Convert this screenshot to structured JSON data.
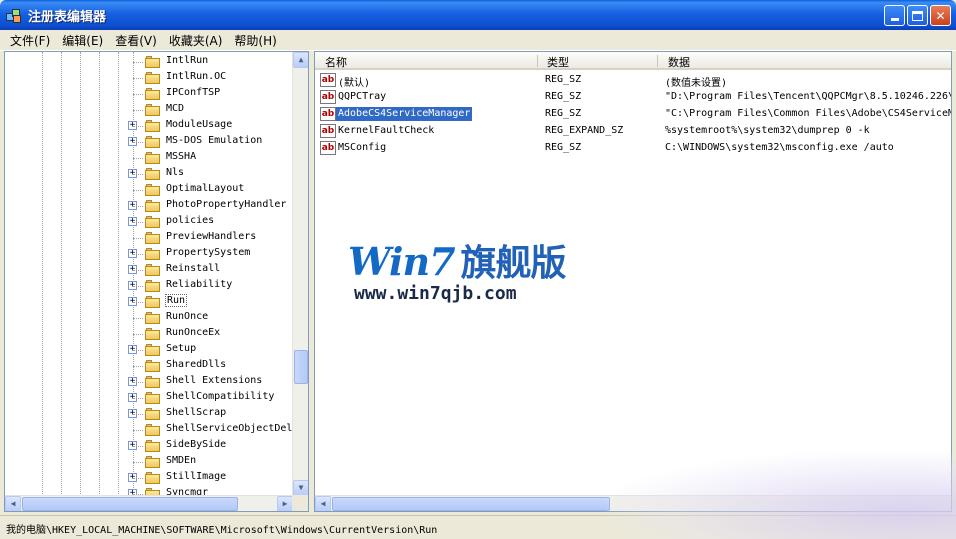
{
  "window": {
    "title": "注册表编辑器"
  },
  "menu": [
    "文件(F)",
    "编辑(E)",
    "查看(V)",
    "收藏夹(A)",
    "帮助(H)"
  ],
  "tree": {
    "items": [
      {
        "label": "IntlRun",
        "expandable": false
      },
      {
        "label": "IntlRun.OC",
        "expandable": false
      },
      {
        "label": "IPConfTSP",
        "expandable": false
      },
      {
        "label": "MCD",
        "expandable": false
      },
      {
        "label": "ModuleUsage",
        "expandable": true
      },
      {
        "label": "MS-DOS Emulation",
        "expandable": true
      },
      {
        "label": "MSSHA",
        "expandable": false
      },
      {
        "label": "Nls",
        "expandable": true
      },
      {
        "label": "OptimalLayout",
        "expandable": false
      },
      {
        "label": "PhotoPropertyHandler",
        "expandable": true
      },
      {
        "label": "policies",
        "expandable": true
      },
      {
        "label": "PreviewHandlers",
        "expandable": false
      },
      {
        "label": "PropertySystem",
        "expandable": true
      },
      {
        "label": "Reinstall",
        "expandable": true
      },
      {
        "label": "Reliability",
        "expandable": true
      },
      {
        "label": "Run",
        "expandable": true,
        "selected": true
      },
      {
        "label": "RunOnce",
        "expandable": false
      },
      {
        "label": "RunOnceEx",
        "expandable": false
      },
      {
        "label": "Setup",
        "expandable": true
      },
      {
        "label": "SharedDlls",
        "expandable": false
      },
      {
        "label": "Shell Extensions",
        "expandable": true
      },
      {
        "label": "ShellCompatibility",
        "expandable": true
      },
      {
        "label": "ShellScrap",
        "expandable": true
      },
      {
        "label": "ShellServiceObjectDel",
        "expandable": false
      },
      {
        "label": "SideBySide",
        "expandable": true
      },
      {
        "label": "SMDEn",
        "expandable": false
      },
      {
        "label": "StillImage",
        "expandable": true
      },
      {
        "label": "Syncmgr",
        "expandable": true
      }
    ]
  },
  "list": {
    "headers": {
      "name": "名称",
      "type": "类型",
      "data": "数据"
    },
    "icon_text": "ab",
    "rows": [
      {
        "name": "(默认)",
        "type": "REG_SZ",
        "data": "(数值未设置)"
      },
      {
        "name": "QQPCTray",
        "type": "REG_SZ",
        "data": "\"D:\\Program Files\\Tencent\\QQPCMgr\\8.5.10246.226\\"
      },
      {
        "name": "AdobeCS4ServiceManager",
        "type": "REG_SZ",
        "data": "\"C:\\Program Files\\Common Files\\Adobe\\CS4ServiceM",
        "selected": true
      },
      {
        "name": "KernelFaultCheck",
        "type": "REG_EXPAND_SZ",
        "data": "%systemroot%\\system32\\dumprep 0 -k"
      },
      {
        "name": "MSConfig",
        "type": "REG_SZ",
        "data": "C:\\WINDOWS\\system32\\msconfig.exe /auto"
      }
    ]
  },
  "watermark": {
    "logo": "Win7",
    "cn": "旗舰版",
    "url": "www.win7qjb.com"
  },
  "status": "我的电脑\\HKEY_LOCAL_MACHINE\\SOFTWARE\\Microsoft\\Windows\\CurrentVersion\\Run",
  "colors": {
    "selection": "#316ac5",
    "titlebar": "#0d4fd1",
    "watermark_blue": "#1469c7"
  }
}
